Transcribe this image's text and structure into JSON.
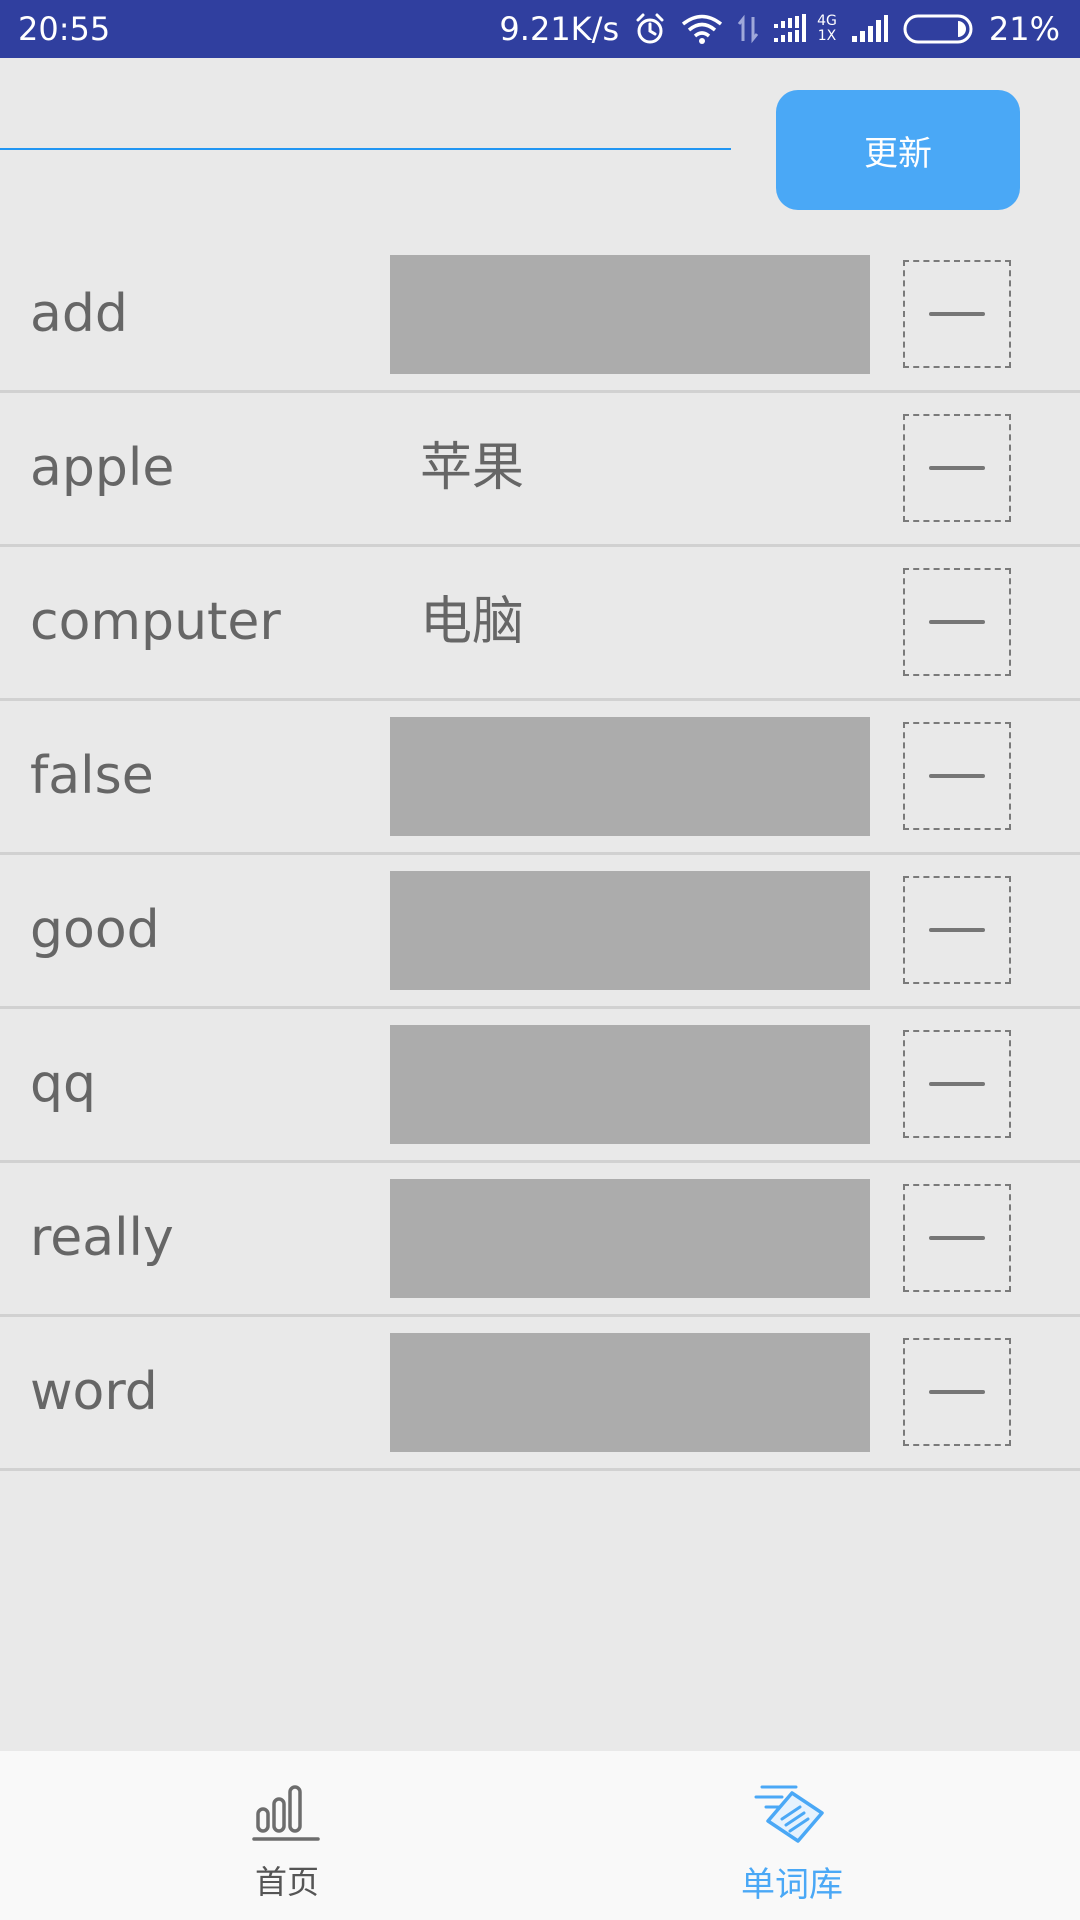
{
  "status_bar": {
    "time": "20:55",
    "net_speed": "9.21K/s",
    "net_gen_top": "4G",
    "net_gen_bottom": "1X",
    "battery": "21%",
    "icons": [
      "alarm-icon",
      "wifi-icon",
      "data-transfer-icon",
      "signal-icon",
      "battery-icon"
    ]
  },
  "search": {
    "value": "",
    "placeholder": ""
  },
  "actions": {
    "update_label": "更新"
  },
  "colors": {
    "status_bar": "#303f9f",
    "accent": "#4aa8f6",
    "input_line": "#2196f3",
    "background": "#e9e9e9",
    "masked_box": "#acacac"
  },
  "words": [
    {
      "en": "add",
      "cn": "",
      "cn_hidden": true
    },
    {
      "en": "apple",
      "cn": "苹果",
      "cn_hidden": false
    },
    {
      "en": "computer",
      "cn": "电脑",
      "cn_hidden": false
    },
    {
      "en": "false",
      "cn": "",
      "cn_hidden": true
    },
    {
      "en": "good",
      "cn": "",
      "cn_hidden": true
    },
    {
      "en": "qq",
      "cn": "",
      "cn_hidden": true
    },
    {
      "en": "really",
      "cn": "",
      "cn_hidden": true
    },
    {
      "en": "word",
      "cn": "",
      "cn_hidden": true
    }
  ],
  "bottom_nav": {
    "items": [
      {
        "label": "首页",
        "icon": "bar-chart-icon",
        "active": false
      },
      {
        "label": "单词库",
        "icon": "word-book-icon",
        "active": true
      }
    ]
  }
}
